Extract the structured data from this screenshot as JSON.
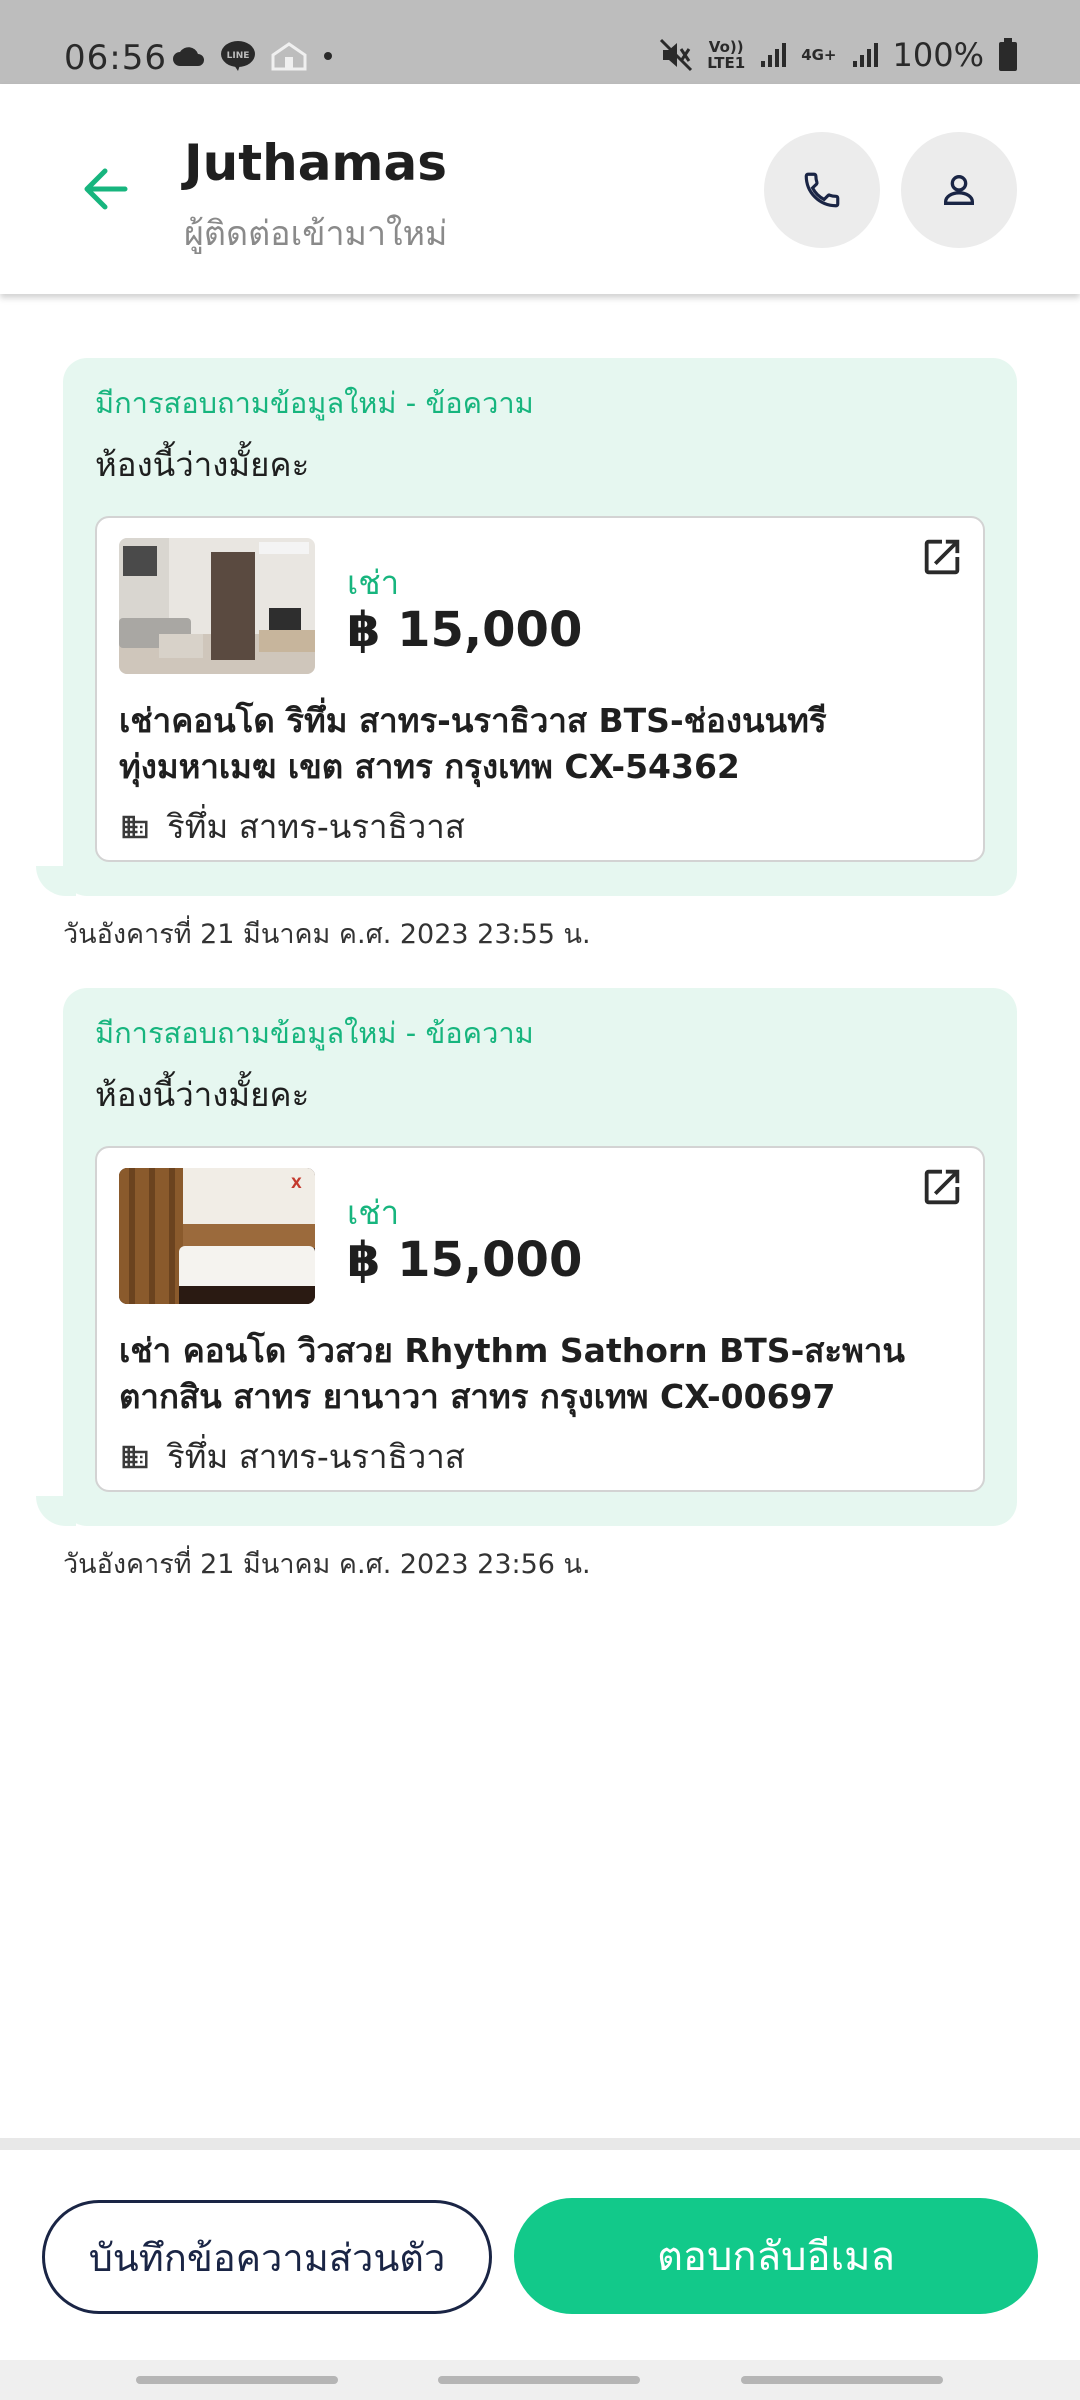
{
  "status_bar": {
    "time": "06:56",
    "left_icons": [
      "cloud-icon",
      "line-app-icon",
      "home-icon",
      "dot-icon"
    ],
    "right_icons": [
      "mute-icon",
      "volte-icon",
      "signal-icon",
      "signal-icon"
    ],
    "volte_label": "Vo))\nLTE1",
    "network_label": "4G+",
    "battery": "100%"
  },
  "header": {
    "contact_name": "Juthamas",
    "contact_subtitle": "ผู้ติดต่อเข้ามาใหม่"
  },
  "messages": [
    {
      "title": "มีการสอบถามข้อมูลใหม่ - ข้อความ",
      "text": "ห้องนี้ว่างมั้ยคะ",
      "listing": {
        "type": "เช่า",
        "price": "฿ 15,000",
        "title": "เช่าคอนโด  ริทึ่ม สาทร-นราธิวาส BTS-ช่องนนทรี ทุ่งมหาเมฆ เขต สาทร กรุงเทพ CX-54362",
        "location": "ริทึ่ม สาทร-นราธิวาส"
      },
      "timestamp": "วันอังคารที่ 21 มีนาคม ค.ศ. 2023 23:55 น."
    },
    {
      "title": "มีการสอบถามข้อมูลใหม่ - ข้อความ",
      "text": "ห้องนี้ว่างมั้ยคะ",
      "listing": {
        "type": "เช่า",
        "price": "฿ 15,000",
        "title": "เช่า คอนโด วิวสวย Rhythm Sathorn BTS-สะพานตากสิน สาทร ยานาวา สาทร กรุงเทพ CX-00697",
        "location": "ริทึ่ม สาทร-นราธิวาส"
      },
      "timestamp": "วันอังคารที่ 21 มีนาคม ค.ศ. 2023 23:56 น."
    }
  ],
  "actions": {
    "note_label": "บันทึกข้อความส่วนตัว",
    "reply_label": "ตอบกลับอีเมล"
  },
  "colors": {
    "accent_green": "#12c98a",
    "bubble_bg": "#e6f7f0",
    "dark_navy": "#1a2545"
  }
}
